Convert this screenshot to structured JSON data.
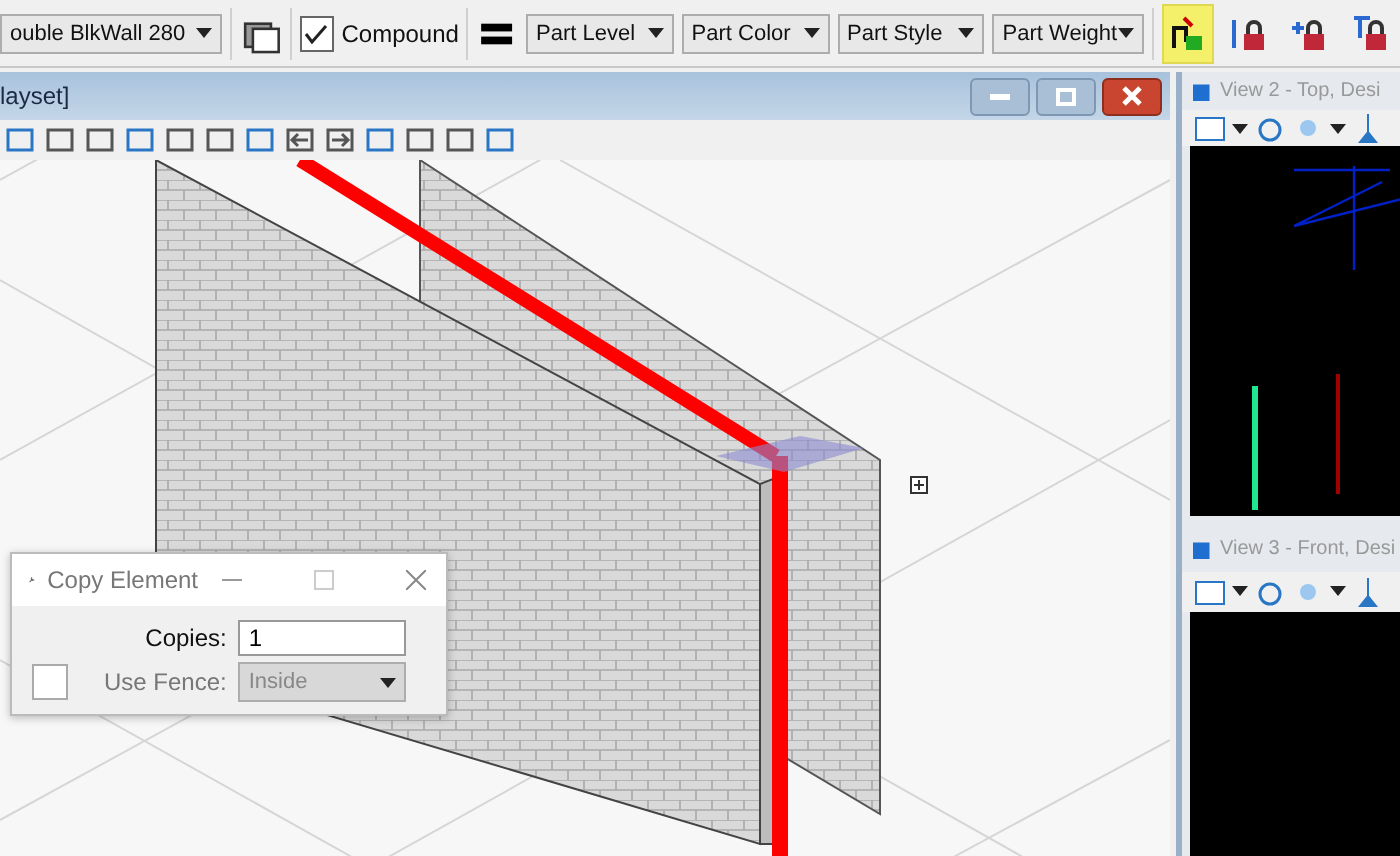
{
  "toolbar": {
    "style_dropdown": "ouble BlkWall 280",
    "compound": {
      "label": "Compound",
      "checked": true
    },
    "dropdowns": [
      "Part Level",
      "Part Color",
      "Part Style",
      "Part Weight"
    ],
    "lock_tools": [
      {
        "selected": true
      },
      {
        "selected": false
      },
      {
        "selected": false
      },
      {
        "selected": false
      }
    ]
  },
  "view_window": {
    "title": "layset]"
  },
  "view_2": {
    "title": "View 2 - Top, Desi"
  },
  "view_3": {
    "title": "View 3 - Front, Desi"
  },
  "dialog": {
    "title": "Copy Element",
    "copies_label": "Copies:",
    "copies_value": "1",
    "use_fence": {
      "label": "Use Fence:",
      "checked": false,
      "value": "Inside",
      "disabled": true
    }
  }
}
